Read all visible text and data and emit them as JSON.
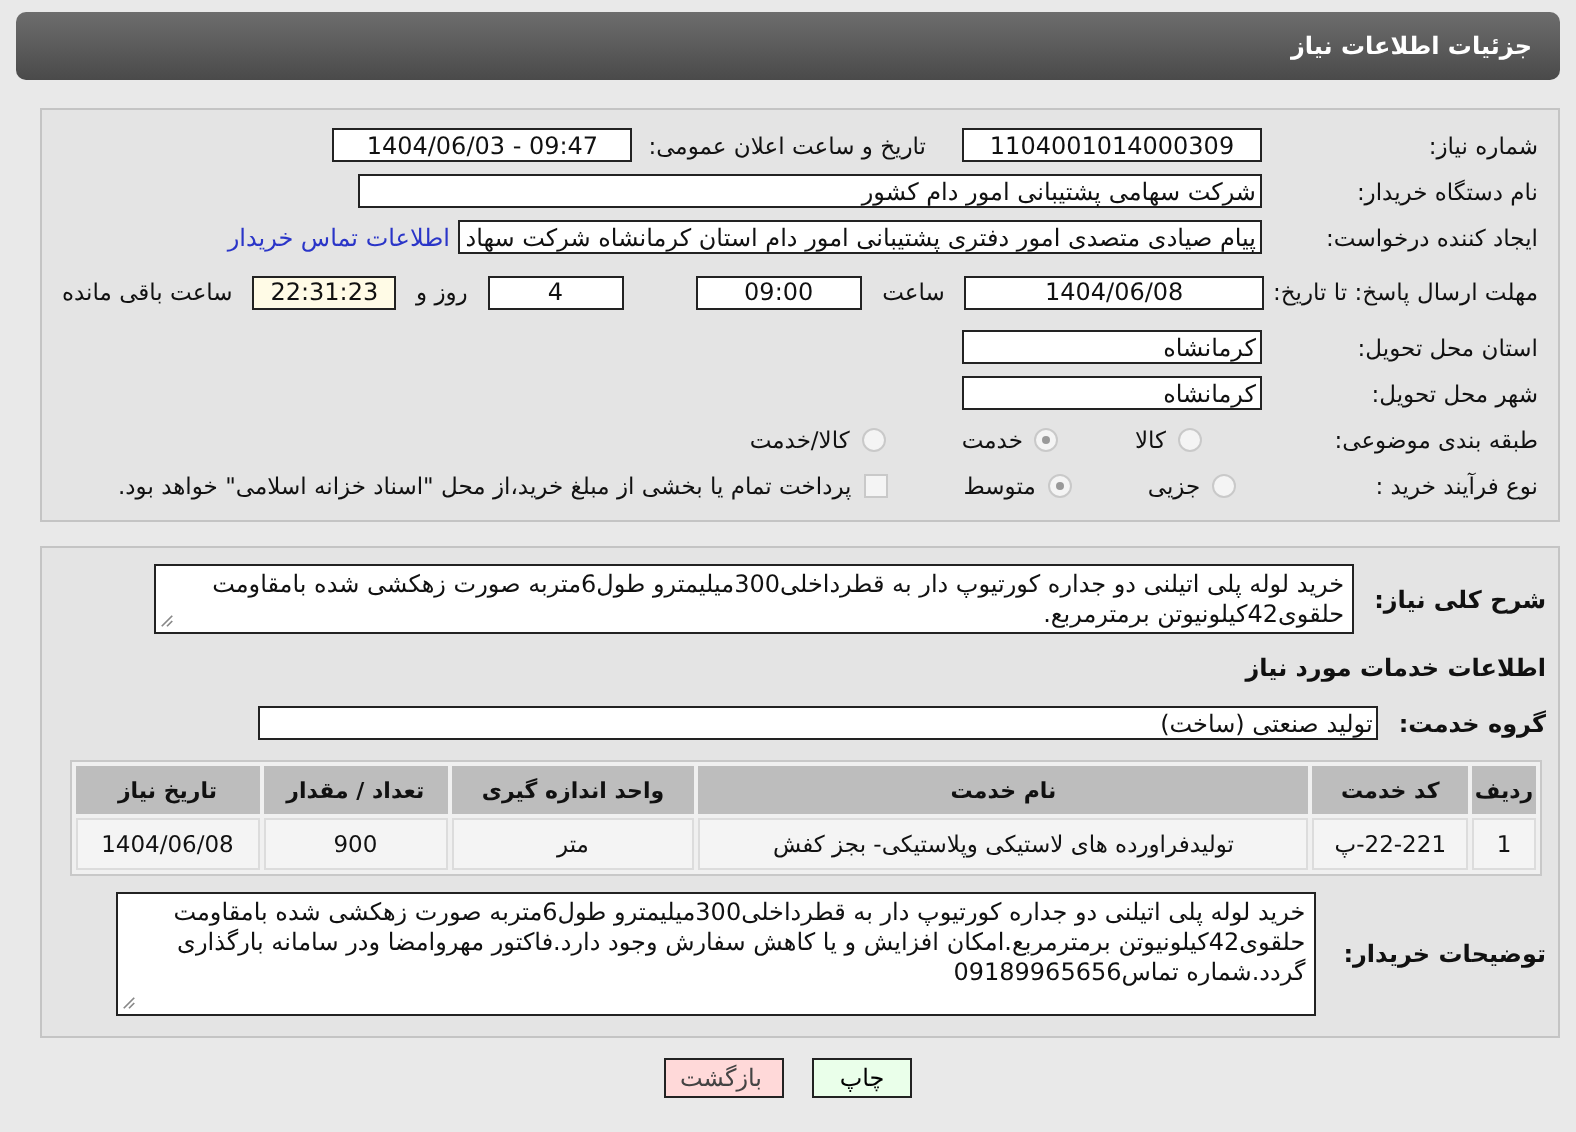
{
  "header": {
    "title": "جزئیات اطلاعات نیاز"
  },
  "need_number": {
    "label": "شماره نیاز:",
    "value": "1104001014000309"
  },
  "announce": {
    "label": "تاریخ و ساعت اعلان عمومی:",
    "value": "1404/06/03 - 09:47"
  },
  "buyer": {
    "label": "نام دستگاه خریدار:",
    "value": "شرکت سهامی پشتیبانی امور دام کشور"
  },
  "creator": {
    "label": "ایجاد کننده درخواست:",
    "value": "پیام صیادی متصدی امور دفتری پشتیبانی امور دام استان کرمانشاه شرکت سهاد",
    "link": "اطلاعات تماس خریدار"
  },
  "deadline": {
    "label": "مهلت ارسال پاسخ: تا تاریخ:",
    "date": "1404/06/08",
    "time_label": "ساعت",
    "time": "09:00",
    "days": "4",
    "days_label": "روز و",
    "remaining": "22:31:23",
    "remaining_label": "ساعت باقی مانده"
  },
  "province": {
    "label": "استان محل تحویل:",
    "value": "کرمانشاه"
  },
  "city": {
    "label": "شهر محل تحویل:",
    "value": "کرمانشاه"
  },
  "category": {
    "label": "طبقه بندی موضوعی:",
    "options": [
      {
        "label": "کالا",
        "selected": false
      },
      {
        "label": "خدمت",
        "selected": true
      },
      {
        "label": "کالا/خدمت",
        "selected": false
      }
    ]
  },
  "process": {
    "label": "نوع فرآیند خرید :",
    "options": [
      {
        "label": "جزیی",
        "selected": false
      },
      {
        "label": "متوسط",
        "selected": true
      }
    ],
    "payment": {
      "label": "پرداخت تمام یا بخشی از مبلغ خرید،از محل \"اسناد خزانه اسلامی\" خواهد بود.",
      "checked": false
    }
  },
  "description": {
    "label": "شرح کلی نیاز:",
    "value": "خرید لوله پلی اتیلنی دو جداره کورتیوپ دار به قطرداخلی300میلیمترو طول6متربه صورت زهکشی شده بامقاومت حلقوی42کیلونیوتن برمترمربع."
  },
  "services_title": "اطلاعات خدمات مورد نیاز",
  "service_group": {
    "label": "گروه خدمت:",
    "value": "تولید صنعتی (ساخت)"
  },
  "table": {
    "columns": [
      "ردیف",
      "کد خدمت",
      "نام خدمت",
      "واحد اندازه گیری",
      "تعداد / مقدار",
      "تاریخ نیاز"
    ],
    "rows": [
      [
        "1",
        "پ-22-221",
        "تولیدفراورده های لاستیکی وپلاستیکی- بجز کفش",
        "متر",
        "900",
        "1404/06/08"
      ]
    ]
  },
  "buyer_notes": {
    "label": "توضیحات خریدار:",
    "value": "خرید لوله پلی اتیلنی دو جداره کورتیوپ دار به قطرداخلی300میلیمترو طول6متربه صورت زهکشی شده بامقاومت حلقوی42کیلونیوتن برمترمربع.امکان افزایش و یا کاهش سفارش وجود دارد.فاکتور مهروامضا ودر سامانه بارگذاری گردد.شماره تماس09189965656"
  },
  "buttons": [
    {
      "label": "چاپ",
      "kind": "print"
    },
    {
      "label": "بازگشت",
      "kind": "back"
    }
  ]
}
